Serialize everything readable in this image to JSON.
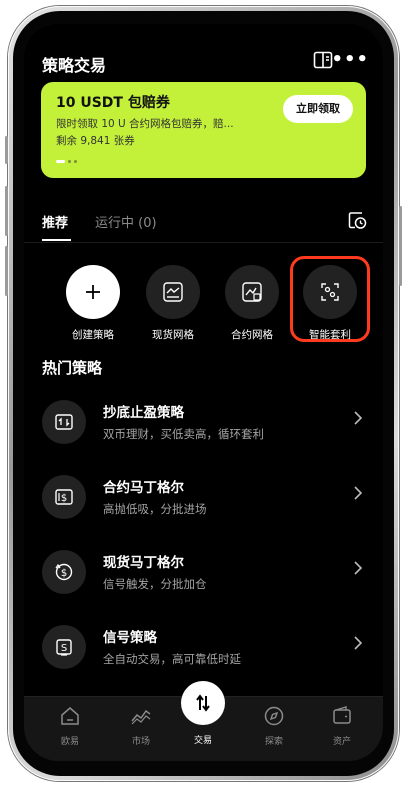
{
  "header": {
    "title": "策略交易",
    "icons": [
      "book-icon",
      "more-icon"
    ]
  },
  "banner": {
    "title": "10 USDT 包赔券",
    "desc": "限时领取 10 U 合约网格包赔券，赔...",
    "remaining": "剩余 9,841 张券",
    "claim_label": "立即领取",
    "bg_color": "#c3f13a"
  },
  "tabs": {
    "recommended": "推荐",
    "running": "运行中 (0)"
  },
  "quick_actions": [
    {
      "label": "创建策略",
      "icon": "plus-icon"
    },
    {
      "label": "现货网格",
      "icon": "spot-grid-icon"
    },
    {
      "label": "合约网格",
      "icon": "contract-grid-icon"
    },
    {
      "label": "智能套利",
      "icon": "arbitrage-icon"
    }
  ],
  "hot_title": "热门策略",
  "strategies": [
    {
      "name": "抄底止盈策略",
      "desc": "双币理财，买低卖高，循环套利",
      "icon": "buy-low-icon"
    },
    {
      "name": "合约马丁格尔",
      "desc": "高抛低吸，分批进场",
      "icon": "contract-martingale-icon"
    },
    {
      "name": "现货马丁格尔",
      "desc": "信号触发，分批加仓",
      "icon": "spot-martingale-icon"
    },
    {
      "name": "信号策略",
      "desc": "全自动交易，高可靠低时延",
      "icon": "signal-icon"
    }
  ],
  "bottom_nav": [
    {
      "label": "欧易",
      "icon": "home-icon"
    },
    {
      "label": "市场",
      "icon": "market-icon"
    },
    {
      "label": "交易",
      "icon": "trade-icon"
    },
    {
      "label": "探索",
      "icon": "compass-icon"
    },
    {
      "label": "资产",
      "icon": "wallet-icon"
    }
  ],
  "highlight_color": "#ff3b1f"
}
